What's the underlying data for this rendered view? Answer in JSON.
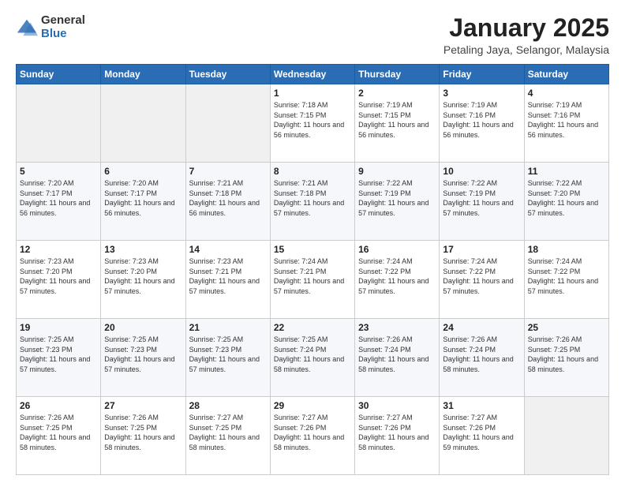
{
  "header": {
    "logo_general": "General",
    "logo_blue": "Blue",
    "month_title": "January 2025",
    "location": "Petaling Jaya, Selangor, Malaysia"
  },
  "weekdays": [
    "Sunday",
    "Monday",
    "Tuesday",
    "Wednesday",
    "Thursday",
    "Friday",
    "Saturday"
  ],
  "weeks": [
    [
      {
        "day": "",
        "sunrise": "",
        "sunset": "",
        "daylight": ""
      },
      {
        "day": "",
        "sunrise": "",
        "sunset": "",
        "daylight": ""
      },
      {
        "day": "",
        "sunrise": "",
        "sunset": "",
        "daylight": ""
      },
      {
        "day": "1",
        "sunrise": "Sunrise: 7:18 AM",
        "sunset": "Sunset: 7:15 PM",
        "daylight": "Daylight: 11 hours and 56 minutes."
      },
      {
        "day": "2",
        "sunrise": "Sunrise: 7:19 AM",
        "sunset": "Sunset: 7:15 PM",
        "daylight": "Daylight: 11 hours and 56 minutes."
      },
      {
        "day": "3",
        "sunrise": "Sunrise: 7:19 AM",
        "sunset": "Sunset: 7:16 PM",
        "daylight": "Daylight: 11 hours and 56 minutes."
      },
      {
        "day": "4",
        "sunrise": "Sunrise: 7:19 AM",
        "sunset": "Sunset: 7:16 PM",
        "daylight": "Daylight: 11 hours and 56 minutes."
      }
    ],
    [
      {
        "day": "5",
        "sunrise": "Sunrise: 7:20 AM",
        "sunset": "Sunset: 7:17 PM",
        "daylight": "Daylight: 11 hours and 56 minutes."
      },
      {
        "day": "6",
        "sunrise": "Sunrise: 7:20 AM",
        "sunset": "Sunset: 7:17 PM",
        "daylight": "Daylight: 11 hours and 56 minutes."
      },
      {
        "day": "7",
        "sunrise": "Sunrise: 7:21 AM",
        "sunset": "Sunset: 7:18 PM",
        "daylight": "Daylight: 11 hours and 56 minutes."
      },
      {
        "day": "8",
        "sunrise": "Sunrise: 7:21 AM",
        "sunset": "Sunset: 7:18 PM",
        "daylight": "Daylight: 11 hours and 57 minutes."
      },
      {
        "day": "9",
        "sunrise": "Sunrise: 7:22 AM",
        "sunset": "Sunset: 7:19 PM",
        "daylight": "Daylight: 11 hours and 57 minutes."
      },
      {
        "day": "10",
        "sunrise": "Sunrise: 7:22 AM",
        "sunset": "Sunset: 7:19 PM",
        "daylight": "Daylight: 11 hours and 57 minutes."
      },
      {
        "day": "11",
        "sunrise": "Sunrise: 7:22 AM",
        "sunset": "Sunset: 7:20 PM",
        "daylight": "Daylight: 11 hours and 57 minutes."
      }
    ],
    [
      {
        "day": "12",
        "sunrise": "Sunrise: 7:23 AM",
        "sunset": "Sunset: 7:20 PM",
        "daylight": "Daylight: 11 hours and 57 minutes."
      },
      {
        "day": "13",
        "sunrise": "Sunrise: 7:23 AM",
        "sunset": "Sunset: 7:20 PM",
        "daylight": "Daylight: 11 hours and 57 minutes."
      },
      {
        "day": "14",
        "sunrise": "Sunrise: 7:23 AM",
        "sunset": "Sunset: 7:21 PM",
        "daylight": "Daylight: 11 hours and 57 minutes."
      },
      {
        "day": "15",
        "sunrise": "Sunrise: 7:24 AM",
        "sunset": "Sunset: 7:21 PM",
        "daylight": "Daylight: 11 hours and 57 minutes."
      },
      {
        "day": "16",
        "sunrise": "Sunrise: 7:24 AM",
        "sunset": "Sunset: 7:22 PM",
        "daylight": "Daylight: 11 hours and 57 minutes."
      },
      {
        "day": "17",
        "sunrise": "Sunrise: 7:24 AM",
        "sunset": "Sunset: 7:22 PM",
        "daylight": "Daylight: 11 hours and 57 minutes."
      },
      {
        "day": "18",
        "sunrise": "Sunrise: 7:24 AM",
        "sunset": "Sunset: 7:22 PM",
        "daylight": "Daylight: 11 hours and 57 minutes."
      }
    ],
    [
      {
        "day": "19",
        "sunrise": "Sunrise: 7:25 AM",
        "sunset": "Sunset: 7:23 PM",
        "daylight": "Daylight: 11 hours and 57 minutes."
      },
      {
        "day": "20",
        "sunrise": "Sunrise: 7:25 AM",
        "sunset": "Sunset: 7:23 PM",
        "daylight": "Daylight: 11 hours and 57 minutes."
      },
      {
        "day": "21",
        "sunrise": "Sunrise: 7:25 AM",
        "sunset": "Sunset: 7:23 PM",
        "daylight": "Daylight: 11 hours and 57 minutes."
      },
      {
        "day": "22",
        "sunrise": "Sunrise: 7:25 AM",
        "sunset": "Sunset: 7:24 PM",
        "daylight": "Daylight: 11 hours and 58 minutes."
      },
      {
        "day": "23",
        "sunrise": "Sunrise: 7:26 AM",
        "sunset": "Sunset: 7:24 PM",
        "daylight": "Daylight: 11 hours and 58 minutes."
      },
      {
        "day": "24",
        "sunrise": "Sunrise: 7:26 AM",
        "sunset": "Sunset: 7:24 PM",
        "daylight": "Daylight: 11 hours and 58 minutes."
      },
      {
        "day": "25",
        "sunrise": "Sunrise: 7:26 AM",
        "sunset": "Sunset: 7:25 PM",
        "daylight": "Daylight: 11 hours and 58 minutes."
      }
    ],
    [
      {
        "day": "26",
        "sunrise": "Sunrise: 7:26 AM",
        "sunset": "Sunset: 7:25 PM",
        "daylight": "Daylight: 11 hours and 58 minutes."
      },
      {
        "day": "27",
        "sunrise": "Sunrise: 7:26 AM",
        "sunset": "Sunset: 7:25 PM",
        "daylight": "Daylight: 11 hours and 58 minutes."
      },
      {
        "day": "28",
        "sunrise": "Sunrise: 7:27 AM",
        "sunset": "Sunset: 7:25 PM",
        "daylight": "Daylight: 11 hours and 58 minutes."
      },
      {
        "day": "29",
        "sunrise": "Sunrise: 7:27 AM",
        "sunset": "Sunset: 7:26 PM",
        "daylight": "Daylight: 11 hours and 58 minutes."
      },
      {
        "day": "30",
        "sunrise": "Sunrise: 7:27 AM",
        "sunset": "Sunset: 7:26 PM",
        "daylight": "Daylight: 11 hours and 58 minutes."
      },
      {
        "day": "31",
        "sunrise": "Sunrise: 7:27 AM",
        "sunset": "Sunset: 7:26 PM",
        "daylight": "Daylight: 11 hours and 59 minutes."
      },
      {
        "day": "",
        "sunrise": "",
        "sunset": "",
        "daylight": ""
      }
    ]
  ]
}
